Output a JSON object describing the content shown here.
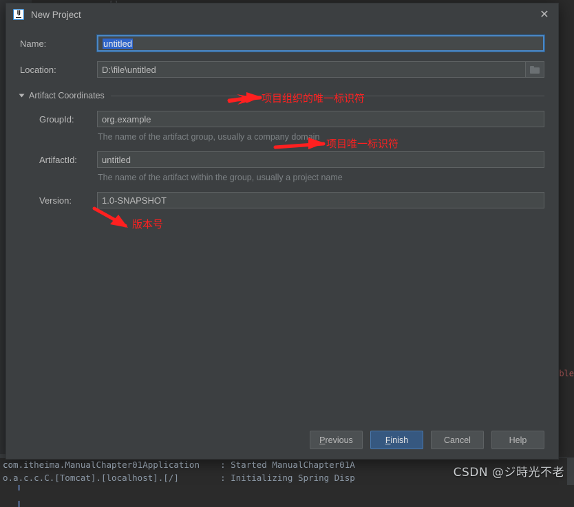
{
  "background": {
    "code_line": "                 .   .      .    . .    . .  [].  . . .  .",
    "warning_text": "nable",
    "console": {
      "line1": "com.itheima.ManualChapter01Application    : Started ManualChapter01A",
      "line2": "o.a.c.c.C.[Tomcat].[localhost].[/]        : Initializing Spring Disp"
    },
    "watermark": "CSDN @ジ時光不老"
  },
  "dialog": {
    "icon": "intellij-idea-icon",
    "title": "New Project",
    "close_label": "✕",
    "fields": {
      "name": {
        "label": "Name:",
        "value": "untitled",
        "selected": true
      },
      "location": {
        "label": "Location:",
        "value": "D:\\file\\untitled",
        "browse_icon": "folder-icon"
      },
      "group_id": {
        "label": "GroupId:",
        "value": "org.example",
        "hint": "The name of the artifact group, usually a company domain"
      },
      "artifact_id": {
        "label": "ArtifactId:",
        "value": "untitled",
        "hint": "The name of the artifact within the group, usually a project name"
      },
      "version": {
        "label": "Version:",
        "value": "1.0-SNAPSHOT"
      }
    },
    "section": {
      "title": "Artifact Coordinates",
      "expanded": true
    },
    "buttons": {
      "previous": {
        "pre": "P",
        "post": "revious"
      },
      "finish": {
        "pre": "F",
        "post": "inish"
      },
      "cancel": {
        "label": "Cancel"
      },
      "help": {
        "label": "Help"
      }
    }
  },
  "annotations": [
    {
      "text": "项目组织的唯一标识符",
      "color": "#ff2020"
    },
    {
      "text": "项目唯一标识符",
      "color": "#ff2020"
    },
    {
      "text": "版本号",
      "color": "#ff2020"
    }
  ],
  "colors": {
    "dialog_bg": "#3c3f41",
    "field_bg": "#45494a",
    "accent": "#365880",
    "focus_border": "#4a88c7",
    "annotation_red": "#ff2020",
    "text": "#bbbbbb"
  }
}
